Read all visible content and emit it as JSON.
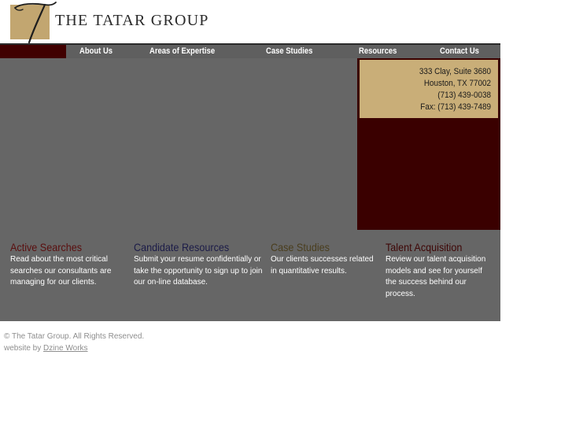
{
  "brand": {
    "name": "THE TATAR GROUP",
    "logo_color": "#c2a670"
  },
  "nav": {
    "items": [
      {
        "label": "About Us"
      },
      {
        "label": "Areas of Expertise"
      },
      {
        "label": "Case Studies"
      },
      {
        "label": "Resources"
      },
      {
        "label": "Contact Us"
      }
    ]
  },
  "contact": {
    "street": "333 Clay, Suite 3680",
    "city": "Houston, TX 77002",
    "phone": "(713) 439-0038",
    "fax": "Fax: (713) 439-7489"
  },
  "promos": [
    {
      "title": "Active Searches",
      "color": "#5a0f0f",
      "text": "Read about the most critical searches our consultants are managing for our clients."
    },
    {
      "title": "Candidate Resources",
      "color": "#1c1c48",
      "text": "Submit your resume confidentially or take the opportunity to sign up to join our on-line database."
    },
    {
      "title": "Case Studies",
      "color": "#4a3e1e",
      "text": "Our clients successes related in quantitative results."
    },
    {
      "title": "Talent Acquisition",
      "color": "#3e0606",
      "text": "Review our talent acquisition models and see for yourself the success behind our process."
    }
  ],
  "footer": {
    "copyright": "© The Tatar Group. All Rights Reserved.",
    "credit_prefix": "website by ",
    "credit_link": "Dzine Works"
  },
  "colors": {
    "nav_bg": "#5f5f5f",
    "nav_accent": "#400000",
    "main_bg": "#666666",
    "contact_panel": "#3a0000",
    "contact_box": "#c9ae78"
  }
}
